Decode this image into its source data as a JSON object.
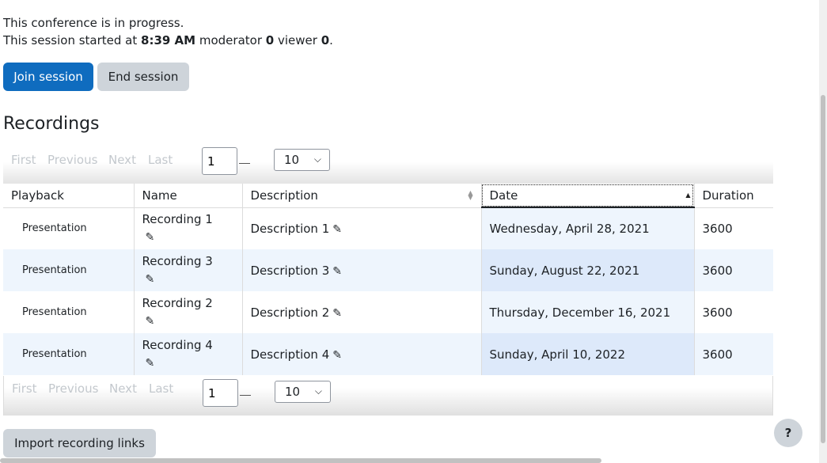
{
  "status": {
    "line1": "This conference is in progress.",
    "started_prefix": "This session started at ",
    "start_time": "8:39 AM",
    "moderator_label": " moderator ",
    "moderator_count": "0",
    "viewer_label": " viewer ",
    "viewer_count": "0",
    "suffix": "."
  },
  "buttons": {
    "join": "Join session",
    "end": "End session",
    "import": "Import recording links",
    "help": "?"
  },
  "recordings_heading": "Recordings",
  "pager": {
    "first": "First",
    "previous": "Previous",
    "next": "Next",
    "last": "Last",
    "page_value": "1",
    "per_page": "10"
  },
  "table": {
    "headers": {
      "playback": "Playback",
      "name": "Name",
      "description": "Description",
      "date": "Date",
      "duration": "Duration"
    },
    "rows": [
      {
        "playback": "Presentation",
        "name": "Recording 1",
        "description": "Description 1",
        "date": "Wednesday, April 28, 2021",
        "duration": "3600"
      },
      {
        "playback": "Presentation",
        "name": "Recording 3",
        "description": "Description 3",
        "date": "Sunday, August 22, 2021",
        "duration": "3600"
      },
      {
        "playback": "Presentation",
        "name": "Recording 2",
        "description": "Description 2",
        "date": "Thursday, December 16, 2021",
        "duration": "3600"
      },
      {
        "playback": "Presentation",
        "name": "Recording 4",
        "description": "Description 4",
        "date": "Sunday, April 10, 2022",
        "duration": "3600"
      }
    ]
  },
  "colors": {
    "primary": "#0f6cbf",
    "secondary": "#ced4da",
    "date_column": "#dde9fa"
  }
}
